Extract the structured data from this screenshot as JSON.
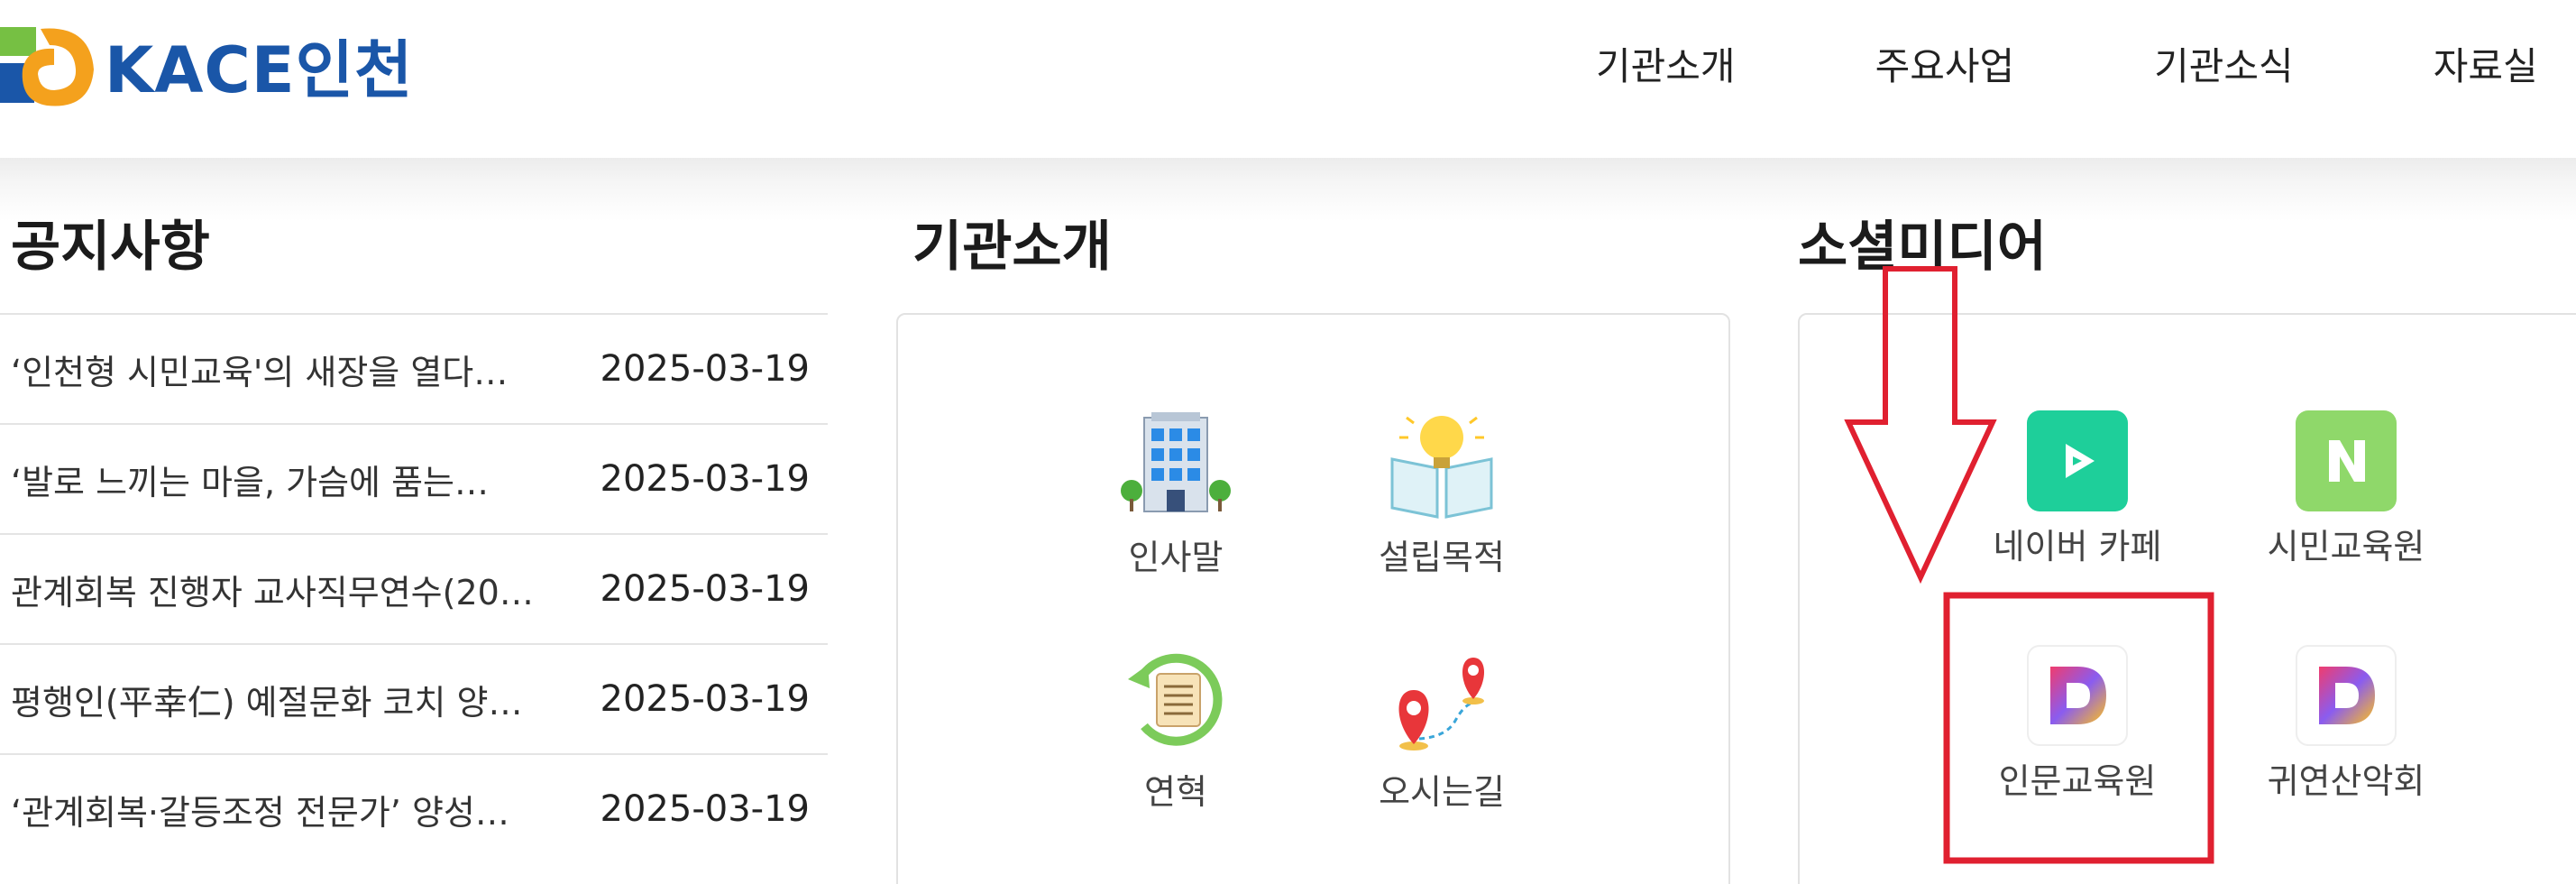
{
  "header": {
    "logo_text": "KACE인천",
    "nav": [
      "기관소개",
      "주요사업",
      "기관소식",
      "자료실"
    ]
  },
  "notices": {
    "title": "공지사항",
    "items": [
      {
        "title": "‘인천형 시민교육'의 새장을 열다…",
        "date": "2025-03-19"
      },
      {
        "title": "‘발로 느끼는 마을, 가슴에 품는…",
        "date": "2025-03-19"
      },
      {
        "title": "관계회복 진행자 교사직무연수(20…",
        "date": "2025-03-19"
      },
      {
        "title": "평행인(平幸仁) 예절문화 코치 양…",
        "date": "2025-03-19"
      },
      {
        "title": "‘관계회복·갈등조정 전문가’ 양성…",
        "date": "2025-03-19"
      }
    ]
  },
  "about": {
    "title": "기관소개",
    "items": [
      {
        "label": "인사말",
        "icon": "building-icon"
      },
      {
        "label": "설립목적",
        "icon": "lightbulb-book-icon"
      },
      {
        "label": "연혁",
        "icon": "history-scroll-icon"
      },
      {
        "label": "오시는길",
        "icon": "map-pin-route-icon"
      }
    ]
  },
  "social": {
    "title": "소셜미디어",
    "items": [
      {
        "label": "네이버 카페",
        "icon": "naver-cafe-icon",
        "color": "#1ecf9a"
      },
      {
        "label": "시민교육원",
        "icon": "naver-blog-icon",
        "color": "#8fd86a"
      },
      {
        "label": "인문교육원",
        "icon": "daum-cafe-icon"
      },
      {
        "label": "귀연산악회",
        "icon": "daum-cafe-icon"
      }
    ]
  },
  "annotation": {
    "color": "#e02030"
  }
}
